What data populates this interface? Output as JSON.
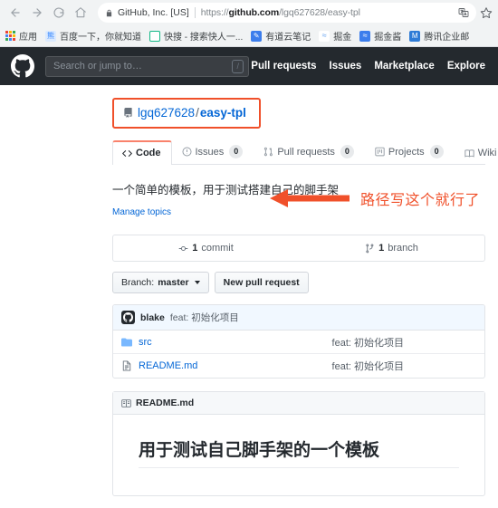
{
  "browser": {
    "nav": {
      "back": "back-arrow",
      "forward": "forward-arrow",
      "reload": "reload",
      "home": "home"
    },
    "omnibox": {
      "lock": "lock-icon",
      "site_name": "GitHub, Inc. [US]",
      "url_scheme": "https://",
      "url_domain": "github.com",
      "url_path": "/lgq627628/easy-tpl",
      "translate_icon": "translate-icon",
      "star_icon": "star-icon"
    },
    "bookmarks": [
      {
        "label": "应用",
        "icon": "apps-grid-icon",
        "color": "#ffffff"
      },
      {
        "label": "百度一下，你就知道",
        "icon": "baidu-icon",
        "color": "#3385ff"
      },
      {
        "label": "快搜 - 搜索快人一...",
        "icon": "kuaisou-icon",
        "color": "#12b886"
      },
      {
        "label": "有道云笔记",
        "icon": "youdao-icon",
        "color": "#3b7dec"
      },
      {
        "label": "掘金",
        "icon": "juejin-icon",
        "color": "#6ba5f0"
      },
      {
        "label": "掘金酱",
        "icon": "juejinjiang-icon",
        "color": "#3b7dec"
      },
      {
        "label": "腾讯企业邮",
        "icon": "tencent-mail-icon",
        "color": "#2e7bd6"
      }
    ]
  },
  "github_header": {
    "logo": "github-mark-icon",
    "search_placeholder": "Search or jump to…",
    "search_value": "",
    "slash_hint": "/",
    "nav": [
      {
        "label": "Pull requests"
      },
      {
        "label": "Issues"
      },
      {
        "label": "Marketplace"
      },
      {
        "label": "Explore"
      }
    ]
  },
  "repo": {
    "owner": "lgq627628",
    "separator": "/",
    "name": "easy-tpl",
    "repo_icon": "repo-icon",
    "description": "一个简单的模板，用于测试搭建自己的脚手架",
    "manage_topics": "Manage topics",
    "tabs": [
      {
        "label": "Code",
        "icon": "code-icon",
        "count": null,
        "selected": true
      },
      {
        "label": "Issues",
        "icon": "issue-opened-icon",
        "count": "0",
        "selected": false
      },
      {
        "label": "Pull requests",
        "icon": "git-pull-request-icon",
        "count": "0",
        "selected": false
      },
      {
        "label": "Projects",
        "icon": "project-board-icon",
        "count": "0",
        "selected": false
      },
      {
        "label": "Wiki",
        "icon": "book-icon",
        "count": null,
        "selected": false
      }
    ],
    "numbers": [
      {
        "icon": "commit-icon",
        "value": "1",
        "label": "commit"
      },
      {
        "icon": "branch-icon",
        "value": "1",
        "label": "branch"
      }
    ],
    "branch_button": {
      "prefix": "Branch:",
      "value": "master"
    },
    "new_pull_request_button": "New pull request",
    "latest_commit": {
      "avatar_icon": "github-avatar-icon",
      "author": "blake",
      "message": "feat: 初始化项目"
    },
    "files": [
      {
        "icon": "folder-icon",
        "name": "src",
        "message": "feat: 初始化项目"
      },
      {
        "icon": "file-icon",
        "name": "README.md",
        "message": "feat: 初始化项目"
      }
    ],
    "readme": {
      "icon": "book-icon",
      "title": "README.md",
      "heading": "用于测试自己脚手架的一个模板"
    }
  },
  "annotation": {
    "arrow": "left-arrow-annotation",
    "text": "路径写这个就行了",
    "color": "#f0502a"
  }
}
